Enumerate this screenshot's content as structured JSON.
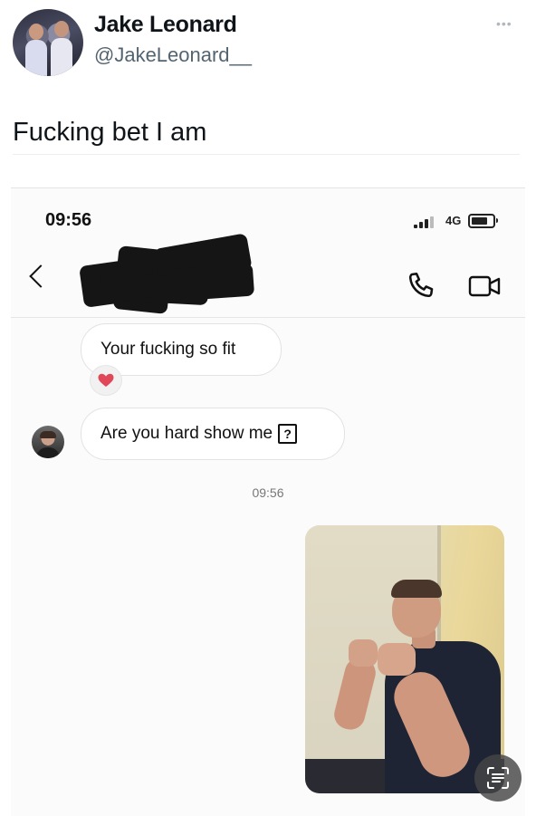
{
  "tweet": {
    "author_name": "Jake Leonard",
    "author_handle": "@JakeLeonard__",
    "text": "Fucking bet I am",
    "more_icon": "more-icon"
  },
  "chat": {
    "status_time": "09:56",
    "network": "4G",
    "icons": {
      "back": "chevron-left-icon",
      "call": "phone-icon",
      "video": "video-camera-icon",
      "scan": "text-scan-icon"
    },
    "messages": [
      {
        "text": "Your fucking so fit",
        "reaction": "red-heart"
      },
      {
        "text": "Are you hard show me",
        "trailing_glyph": "?"
      }
    ],
    "message_time": "09:56"
  },
  "colors": {
    "handle_gray": "#536471",
    "reaction_heart": "#e0485a",
    "bubble_border": "#e2e2e2"
  }
}
